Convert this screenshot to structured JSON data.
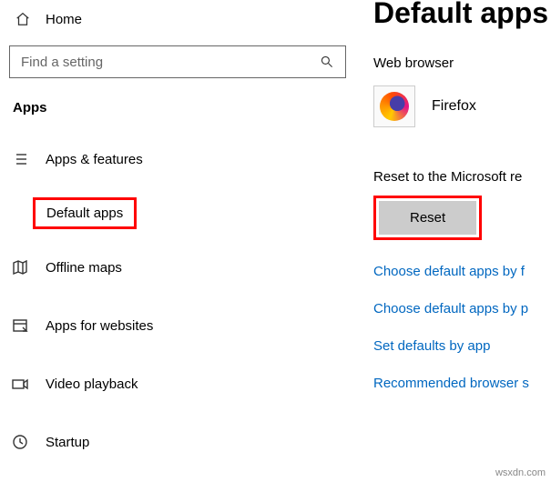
{
  "sidebar": {
    "home": "Home",
    "search_placeholder": "Find a setting",
    "section": "Apps",
    "items": [
      {
        "label": "Apps & features"
      },
      {
        "label": "Default apps"
      },
      {
        "label": "Offline maps"
      },
      {
        "label": "Apps for websites"
      },
      {
        "label": "Video playback"
      },
      {
        "label": "Startup"
      }
    ]
  },
  "main": {
    "title": "Default apps",
    "web_browser_label": "Web browser",
    "browser_name": "Firefox",
    "reset_label": "Reset to the Microsoft re",
    "reset_button": "Reset",
    "links": [
      "Choose default apps by f",
      "Choose default apps by p",
      "Set defaults by app",
      "Recommended browser s"
    ]
  },
  "watermark": "wsxdn.com"
}
